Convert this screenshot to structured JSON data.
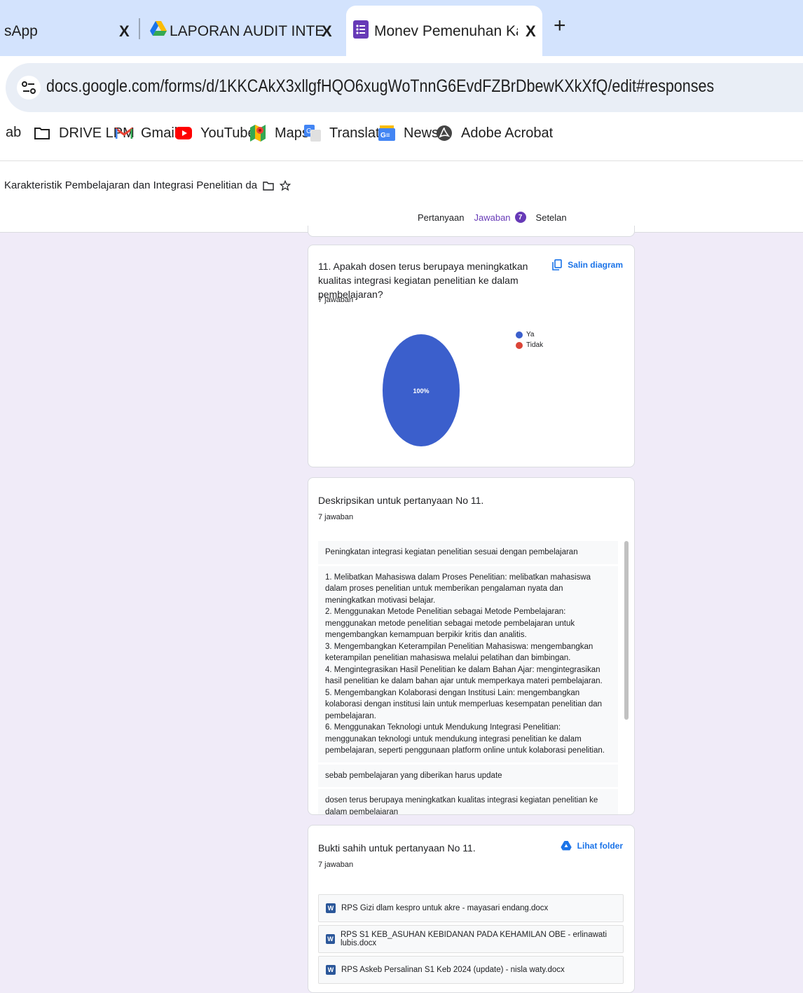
{
  "browser": {
    "tabs": [
      {
        "title": "sApp",
        "active": false
      },
      {
        "title": "LAPORAN AUDIT INTERNAL RE",
        "active": false
      },
      {
        "title": "Monev Pemenuhan Karakteristi",
        "active": true
      }
    ],
    "close_glyph": "X",
    "new_tab_glyph": "+",
    "url": "docs.google.com/forms/d/1KKCAkX3xllgfHQO6xugWoTnnG6EvdFZBrDbewKXkXfQ/edit#responses",
    "bookmarks": [
      {
        "label": "ab",
        "icon": "none"
      },
      {
        "label": "DRIVE LPM",
        "icon": "folder-icon"
      },
      {
        "label": "Gmail",
        "icon": "gmail-icon"
      },
      {
        "label": "YouTube",
        "icon": "youtube-icon"
      },
      {
        "label": "Maps",
        "icon": "maps-icon"
      },
      {
        "label": "Translate",
        "icon": "translate-icon"
      },
      {
        "label": "News",
        "icon": "news-icon"
      },
      {
        "label": "Adobe Acrobat",
        "icon": "acrobat-icon"
      }
    ]
  },
  "form": {
    "title": "Karakteristik Pembelajaran dan Integrasi Penelitian da",
    "tabs": {
      "questions": "Pertanyaan",
      "responses": "Jawaban",
      "responses_count": "7",
      "settings": "Setelan"
    },
    "accent": "#673ab7"
  },
  "q11": {
    "question": "11. Apakah dosen terus berupaya meningkatkan kualitas integrasi kegiatan penelitian ke dalam pembelajaran?",
    "count": "7 jawaban",
    "copy_label": "Salin diagram",
    "chart_data": {
      "type": "pie",
      "slices": [
        {
          "label": "Ya",
          "value": 100,
          "color": "#3b5fcc"
        },
        {
          "label": "Tidak",
          "value": 0,
          "color": "#db4437"
        }
      ],
      "center_label": "100%"
    }
  },
  "q11_desc": {
    "question": "Deskripsikan untuk pertanyaan No 11.",
    "count": "7 jawaban",
    "responses": [
      "Peningkatan integrasi kegiatan penelitian sesuai dengan pembelajaran",
      "1. Melibatkan Mahasiswa dalam Proses Penelitian: melibatkan mahasiswa dalam proses penelitian untuk memberikan pengalaman nyata dan meningkatkan motivasi belajar.\n2. Menggunakan Metode Penelitian sebagai Metode Pembelajaran: menggunakan metode penelitian sebagai metode pembelajaran untuk mengembangkan kemampuan berpikir kritis dan analitis.\n3. Mengembangkan Keterampilan Penelitian Mahasiswa: mengembangkan keterampilan penelitian mahasiswa melalui pelatihan dan bimbingan.\n4. Mengintegrasikan Hasil Penelitian ke dalam Bahan Ajar: mengintegrasikan hasil penelitian ke dalam bahan ajar untuk memperkaya materi pembelajaran.\n5. Mengembangkan Kolaborasi dengan Institusi Lain: mengembangkan kolaborasi dengan institusi lain untuk memperluas kesempatan penelitian dan pembelajaran.\n6. Menggunakan Teknologi untuk Mendukung Integrasi Penelitian: menggunakan teknologi untuk mendukung integrasi penelitian ke dalam pembelajaran, seperti penggunaan platform online untuk kolaborasi penelitian.",
      "sebab pembelajaran yang diberikan harus update",
      "dosen terus berupaya meningkatkan kualitas integrasi kegiatan penelitian ke dalam pembelajaran"
    ]
  },
  "q11_evidence": {
    "question": "Bukti sahih untuk pertanyaan No 11.",
    "count": "7 jawaban",
    "folder_label": "Lihat folder",
    "files": [
      "RPS Gizi dlam kespro untuk akre - mayasari endang.docx",
      "RPS S1 KEB_ASUHAN KEBIDANAN PADA KEHAMILAN OBE - erlinawati lubis.docx",
      "RPS Askeb Persalinan S1 Keb 2024 (update) - nisla waty.docx"
    ]
  }
}
